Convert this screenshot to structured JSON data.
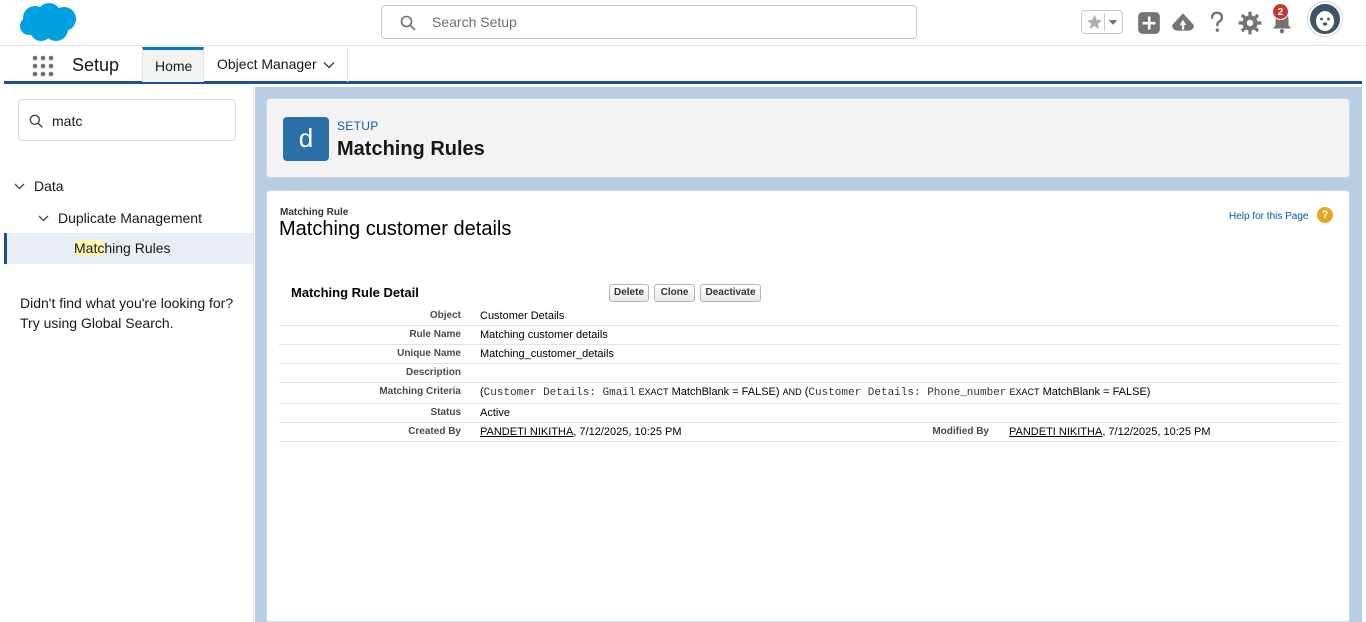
{
  "header": {
    "search_placeholder": "Search Setup",
    "notification_count": "2"
  },
  "context_bar": {
    "app_name": "Setup",
    "tabs": [
      {
        "label": "Home"
      },
      {
        "label": "Object Manager"
      }
    ]
  },
  "sidebar": {
    "quick_find_value": "matc",
    "tree": {
      "data_label": "Data",
      "dup_label": "Duplicate Management",
      "match_highlight": "Matc",
      "match_rest": "hing Rules"
    },
    "not_found_line1": "Didn't find what you're looking for?",
    "not_found_line2": "Try using Global Search."
  },
  "page_header": {
    "eyebrow": "SETUP",
    "title": "Matching Rules",
    "icon_letter": "d"
  },
  "content": {
    "eyebrow": "Matching Rule",
    "title": "Matching customer details",
    "help_link": "Help for this Page",
    "help_icon_glyph": "?",
    "detail_title": "Matching Rule Detail",
    "buttons": {
      "delete": "Delete",
      "clone": "Clone",
      "deactivate": "Deactivate"
    },
    "fields": {
      "object_label": "Object",
      "object_value": "Customer Details",
      "rule_name_label": "Rule Name",
      "rule_name_value": "Matching customer details",
      "unique_name_label": "Unique Name",
      "unique_name_value": "Matching_customer_details",
      "description_label": "Description",
      "description_value": "",
      "criteria_label": "Matching Criteria",
      "criteria": {
        "open1": "(",
        "field1": "Customer Details: Gmail",
        "exact1": "EXACT",
        "blank1": "MatchBlank = FALSE)",
        "and": "AND",
        "open2": "(",
        "field2": "Customer Details: Phone_number",
        "exact2": "EXACT",
        "blank2": "MatchBlank = FALSE)"
      },
      "status_label": "Status",
      "status_value": "Active",
      "created_by_label": "Created By",
      "created_by_user": "PANDETI NIKITHA",
      "created_by_date": ", 7/12/2025, 10:25 PM",
      "modified_by_label": "Modified By",
      "modified_by_user": "PANDETI NIKITHA",
      "modified_by_date": ", 7/12/2025, 10:25 PM"
    }
  },
  "colors": {
    "brand_blue": "#00a1e0",
    "nav_accent": "#1b5297",
    "main_background": "#b8cce4",
    "badge_red": "#c23934"
  }
}
